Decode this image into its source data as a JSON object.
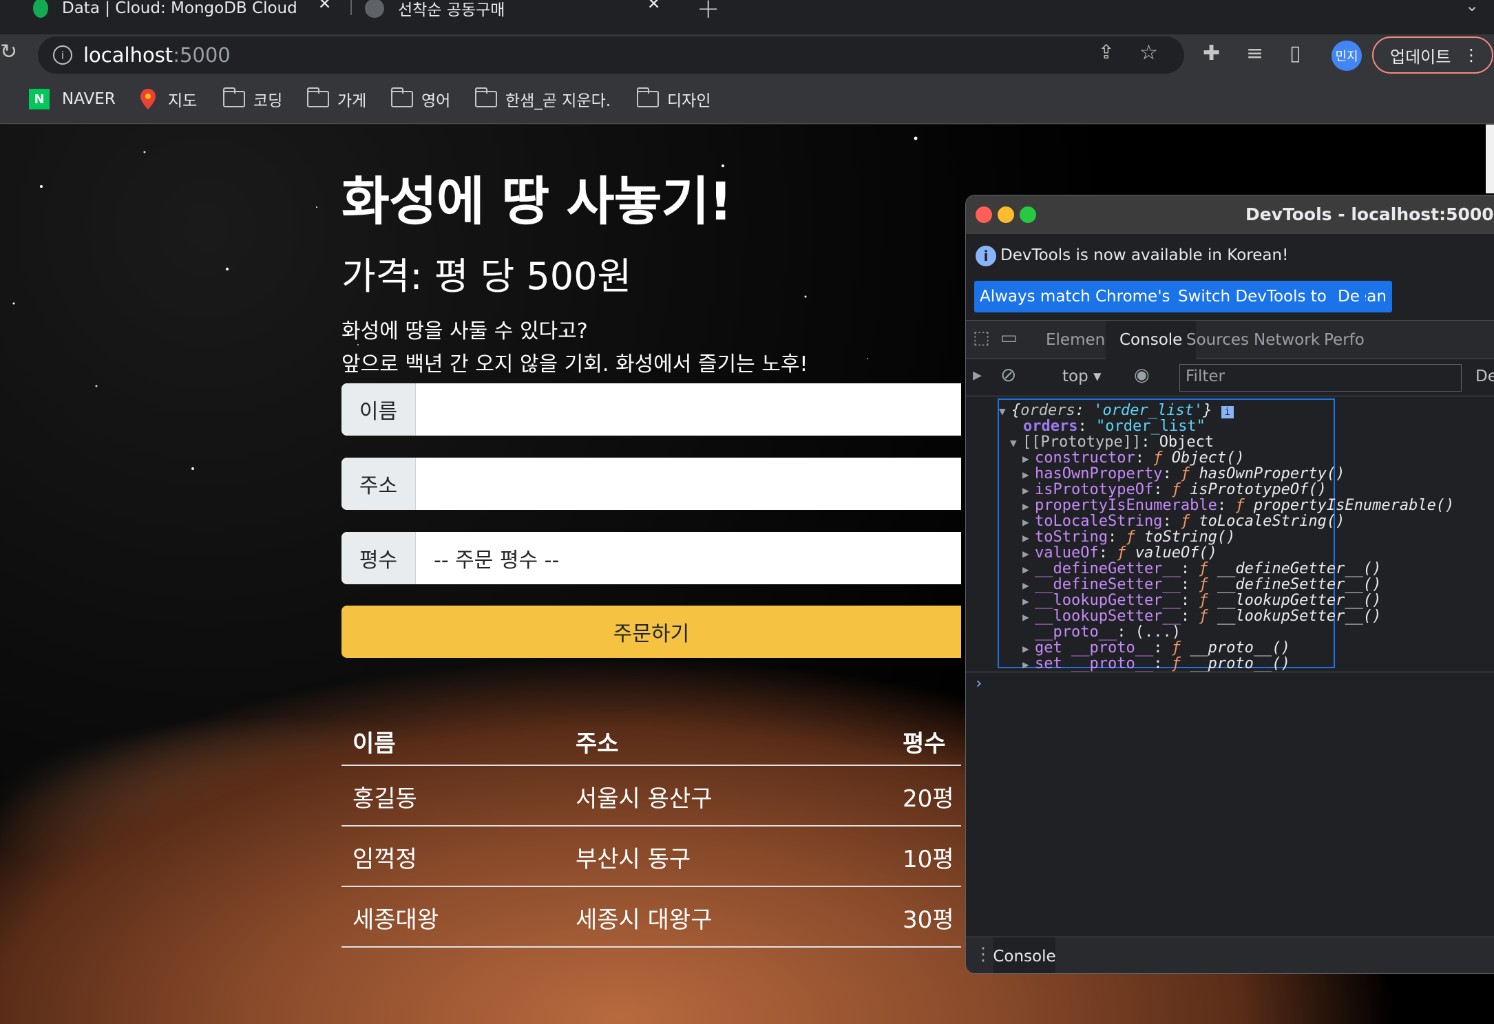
{
  "browser": {
    "tabs": [
      {
        "title": "Data | Cloud: MongoDB Cloud"
      },
      {
        "title": "선착순 공동구매"
      }
    ],
    "url_host": "localhost",
    "url_port": ":5000",
    "profile": "민지",
    "update_label": "업데이트",
    "bookmarks": [
      {
        "label": "NAVER",
        "icon": "naver-icon"
      },
      {
        "label": "지도",
        "icon": "maps-pin-icon"
      },
      {
        "label": "코딩",
        "icon": "folder-icon"
      },
      {
        "label": "가게",
        "icon": "folder-icon"
      },
      {
        "label": "영어",
        "icon": "folder-icon"
      },
      {
        "label": "한샘_곧 지운다.",
        "icon": "folder-icon"
      },
      {
        "label": "디자인",
        "icon": "folder-icon"
      }
    ]
  },
  "page": {
    "title": "화성에 땅 사놓기!",
    "price": "가격: 평 당 500원",
    "desc1": "화성에 땅을 사둘 수 있다고?",
    "desc2": "앞으로 백년 간 오지 않을 기회. 화성에서 즐기는 노후!",
    "form": {
      "name_label": "이름",
      "name_value": "",
      "address_label": "주소",
      "address_value": "",
      "size_label": "평수",
      "size_value": "-- 주문 평수 --"
    },
    "order_button": "주문하기",
    "table": {
      "headers": [
        "이름",
        "주소",
        "평수"
      ],
      "rows": [
        [
          "홍길동",
          "서울시 용산구",
          "20평"
        ],
        [
          "임꺽정",
          "부산시 동구",
          "10평"
        ],
        [
          "세종대왕",
          "세종시 대왕구",
          "30평"
        ]
      ]
    }
  },
  "devtools": {
    "title": "DevTools - localhost:5000/",
    "info_message": "DevTools is now available in Korean!",
    "btn_match": "Always match Chrome's language",
    "btn_switch": "Switch DevTools to Korean",
    "btn_more": "De",
    "tabs": [
      "Elements",
      "Console",
      "Sources",
      "Network",
      "Perfo"
    ],
    "active_tab": "Console",
    "context": "top",
    "filter_placeholder": "Filter",
    "levels": "De",
    "drawer_tab": "Console",
    "object": {
      "summary_key": "orders",
      "summary_val": "'order_list'",
      "prop_key": "orders",
      "prop_val": "\"order_list\"",
      "prototype": "[[Prototype]]",
      "prototype_val": "Object",
      "members": [
        {
          "key": "constructor",
          "fn": "Object()"
        },
        {
          "key": "hasOwnProperty",
          "fn": "hasOwnProperty()"
        },
        {
          "key": "isPrototypeOf",
          "fn": "isPrototypeOf()"
        },
        {
          "key": "propertyIsEnumerable",
          "fn": "propertyIsEnumerable()"
        },
        {
          "key": "toLocaleString",
          "fn": "toLocaleString()"
        },
        {
          "key": "toString",
          "fn": "toString()"
        },
        {
          "key": "valueOf",
          "fn": "valueOf()"
        },
        {
          "key": "__defineGetter__",
          "fn": "__defineGetter__()"
        },
        {
          "key": "__defineSetter__",
          "fn": "__defineSetter__()"
        },
        {
          "key": "__lookupGetter__",
          "fn": "__lookupGetter__()"
        },
        {
          "key": "__lookupSetter__",
          "fn": "__lookupSetter__()"
        }
      ],
      "proto_key": "__proto__",
      "proto_val": "(...)",
      "get_proto": "get __proto__",
      "get_proto_fn": "__proto__()",
      "set_proto": "set __proto__",
      "set_proto_fn": "__proto__()"
    }
  }
}
